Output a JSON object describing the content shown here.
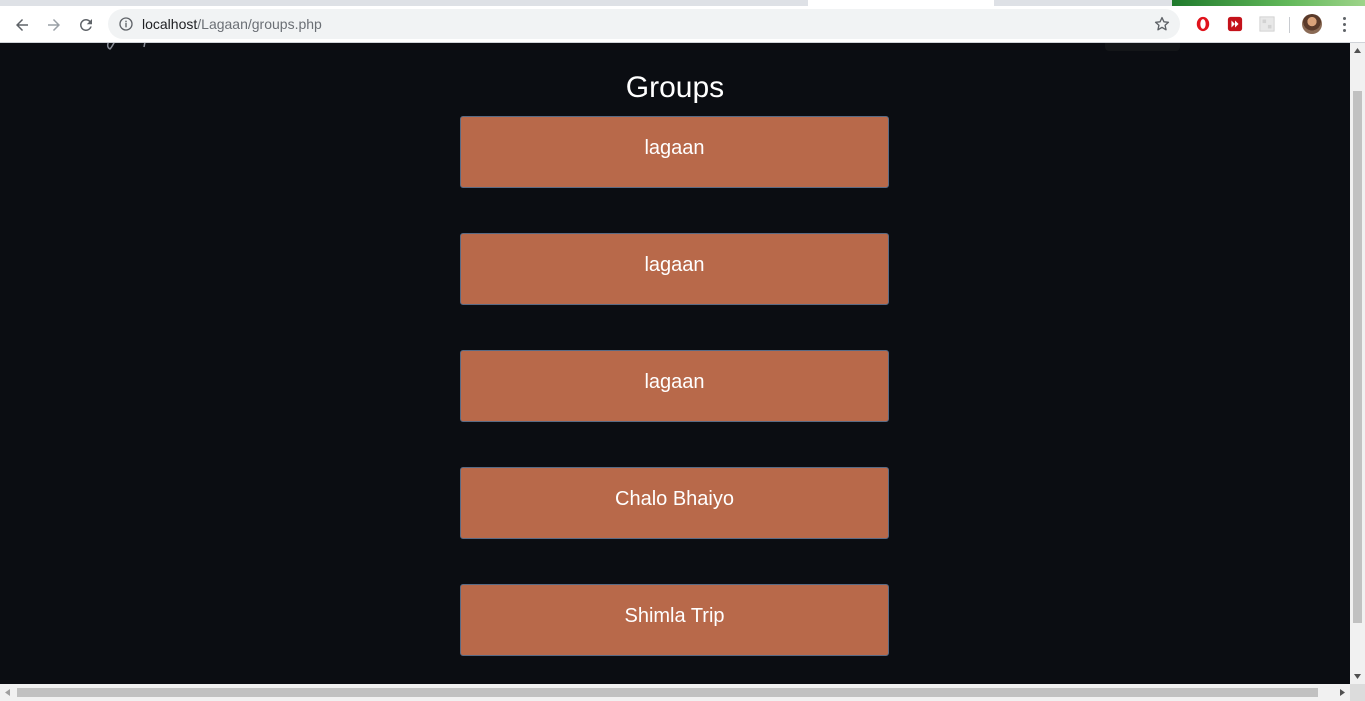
{
  "browser": {
    "url_host": "localhost",
    "url_path": "/Lagaan/groups.php",
    "icons": {
      "back": "back-arrow-icon",
      "forward": "forward-arrow-icon",
      "reload": "reload-icon",
      "info": "info-icon",
      "bookmark": "star-icon",
      "ext1": "opera-icon",
      "ext2": "media-extension-icon",
      "ext3": "grid-extension-icon",
      "profile": "avatar",
      "menu": "kebab-menu-icon"
    }
  },
  "page": {
    "title": "Groups",
    "groups": [
      {
        "label": "lagaan"
      },
      {
        "label": "lagaan"
      },
      {
        "label": "lagaan"
      },
      {
        "label": "Chalo Bhaiyo"
      },
      {
        "label": "Shimla Trip"
      }
    ]
  },
  "colors": {
    "background": "#0b0d12",
    "group_button": "#b8694a",
    "group_button_border": "#5a6a84",
    "text": "#ffffff"
  }
}
